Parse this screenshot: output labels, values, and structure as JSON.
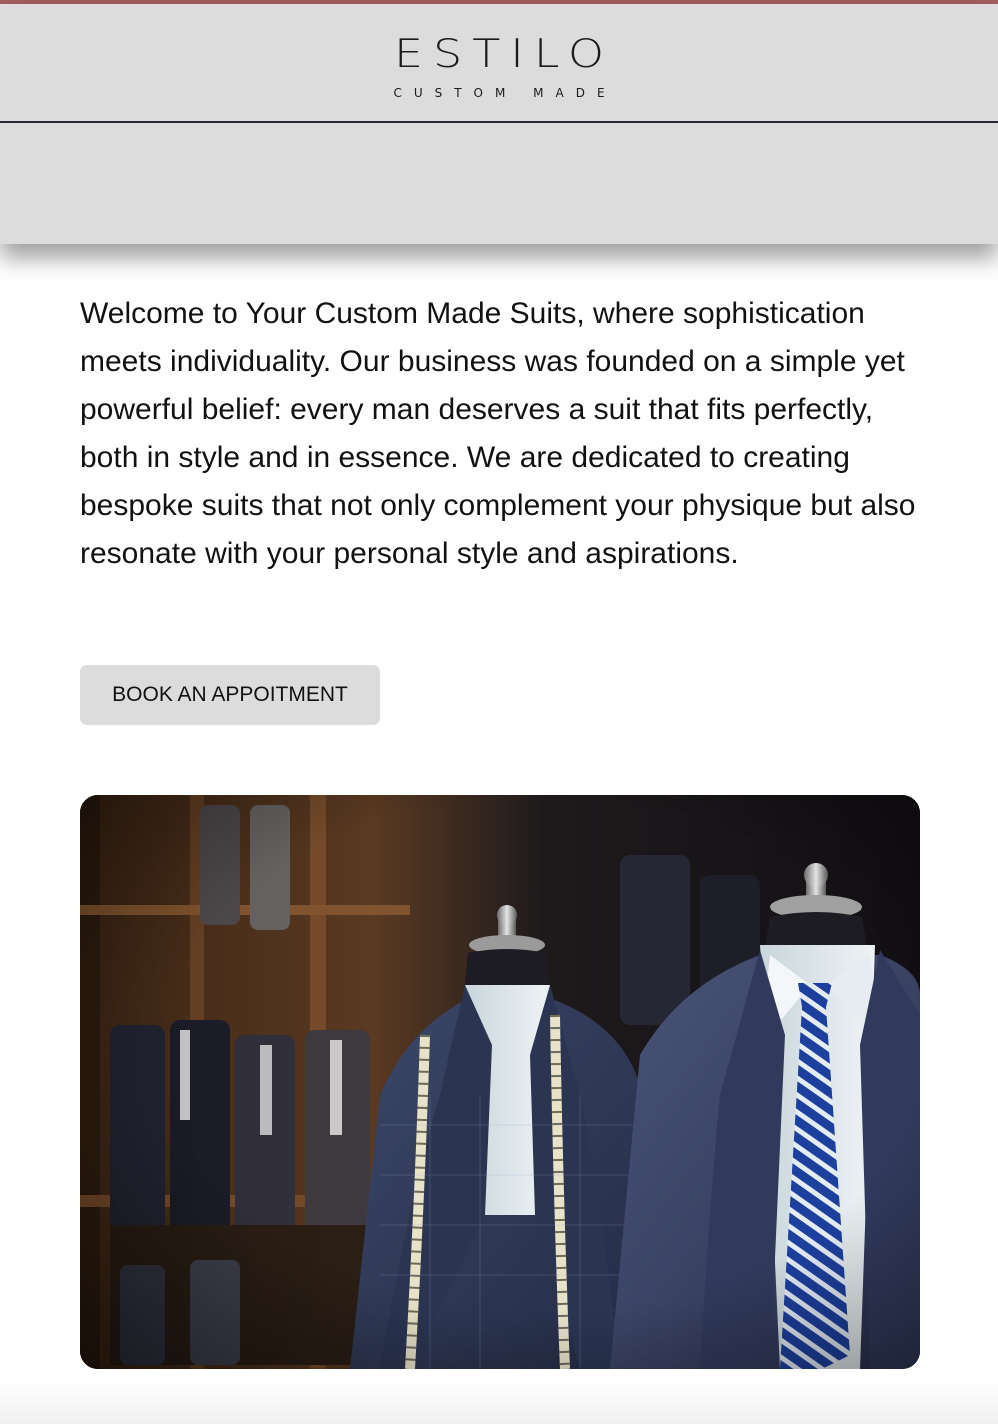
{
  "brand": {
    "name": "ESTILO",
    "tagline": "CUSTOM MADE"
  },
  "main": {
    "intro": "Welcome to Your Custom Made Suits, where sophistication meets individuality. Our business was founded on a simple yet powerful belief: every man deserves a suit that fits perfectly, both in style and in essence. We are dedicated to creating bespoke suits that not only complement your physique but also resonate with your personal style and aspirations.",
    "cta_label": "BOOK AN APPOITMENT"
  },
  "colors": {
    "accent_bar": "#a45e5e",
    "header_bg": "#dcdcdc",
    "header_rule": "#27273b",
    "button_bg": "#dcdcdc"
  }
}
